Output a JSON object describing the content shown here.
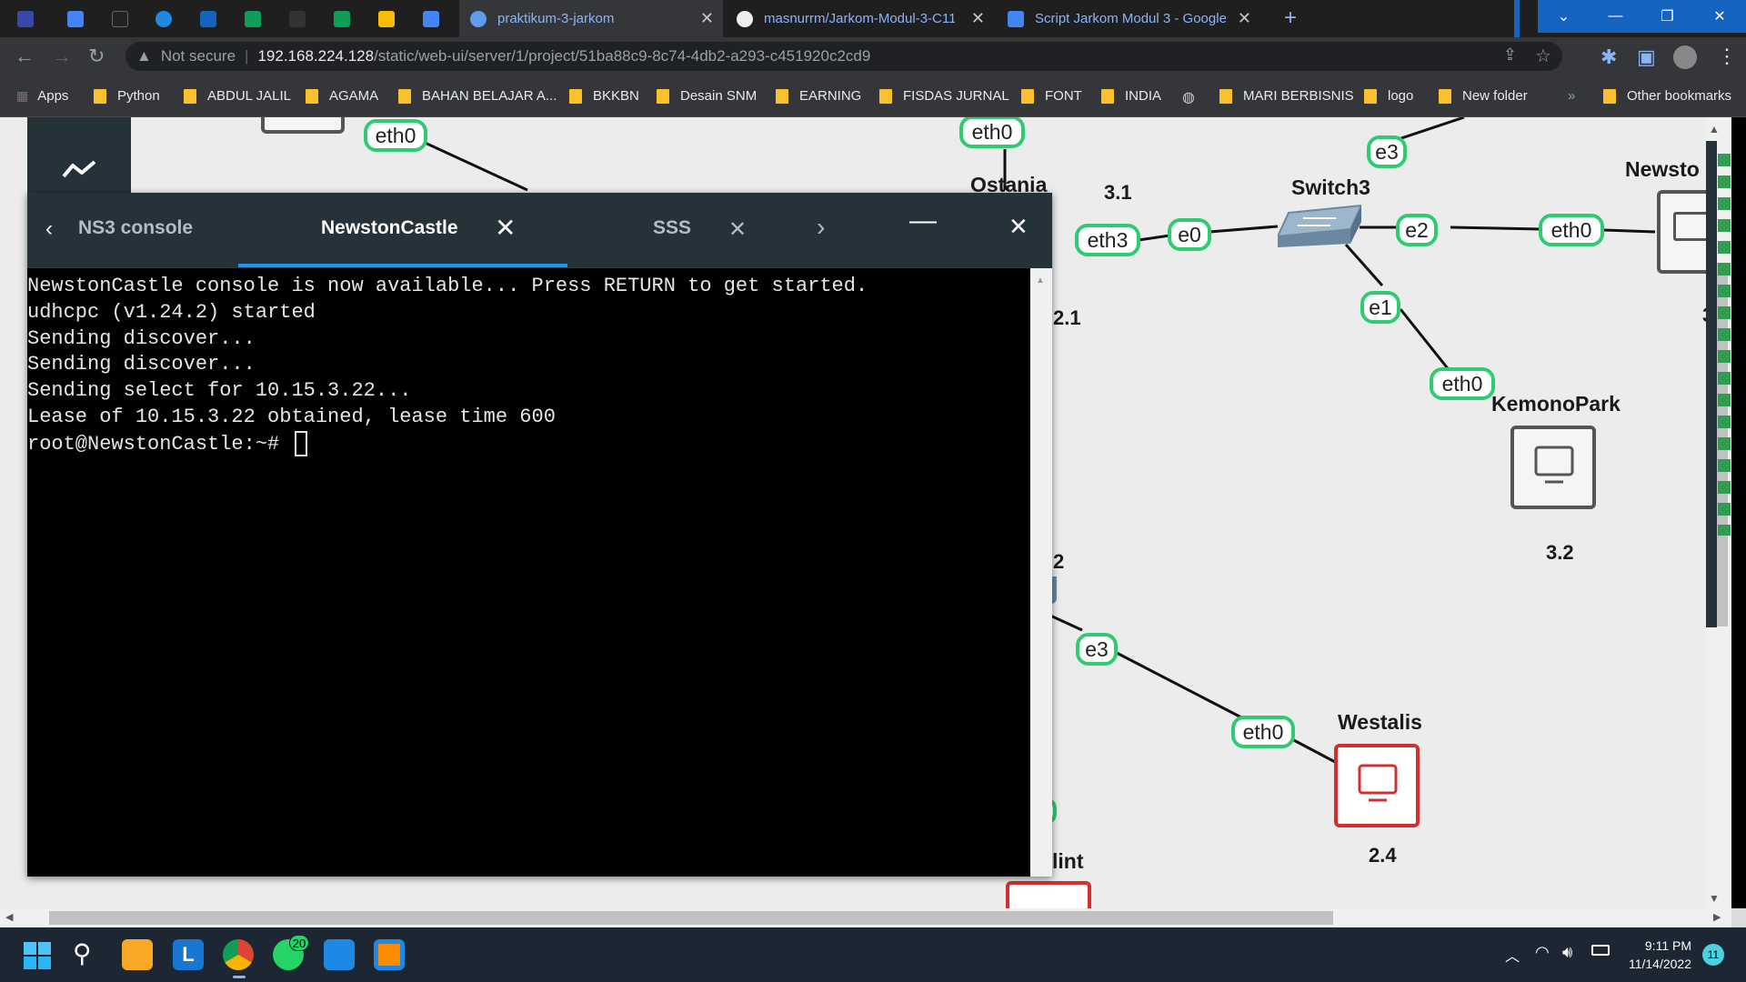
{
  "browser": {
    "tabs": [
      {
        "label": "praktikum-3-jarkom",
        "active": true
      },
      {
        "label": "masnurrm/Jarkom-Modul-3-C11",
        "active": false
      },
      {
        "label": "Script Jarkom Modul 3 - Google",
        "active": false
      }
    ],
    "new_tab": "+",
    "security": "Not secure",
    "url_host": "192.168.224.128",
    "url_path": "/static/web-ui/server/1/project/51ba88c9-8c74-4db2-a293-c451920c2cd9",
    "bookmarks": [
      "Apps",
      "Python",
      "ABDUL JALIL",
      "AGAMA",
      "BAHAN BELAJAR A...",
      "BKKBN",
      "Desain SNM",
      "EARNING",
      "FISDAS JURNAL",
      "FONT",
      "INDIA",
      "MARI BERBISNIS",
      "logo",
      "New folder"
    ],
    "bookmarks_more": "»",
    "other_bookmarks": "Other bookmarks"
  },
  "topology": {
    "nodes": {
      "ostania": "Ostania",
      "switch3": "Switch3",
      "newston": "Newsto",
      "kemonopark": "KemonoPark",
      "westalis": "Westalis",
      "flint": "lint"
    },
    "ip_labels": {
      "ostania_net": "3.1",
      "left_mid": "2.1",
      "kemono_ip": "3.2",
      "westalis_ip": "2.4",
      "lower_left": "2",
      "newston_partial": "3"
    },
    "interfaces": {
      "top_left_eth0": "eth0",
      "ostania_eth0": "eth0",
      "switch_e3": "e3",
      "ostania_eth3": "eth3",
      "switch_e0": "e0",
      "switch_e2": "e2",
      "newston_eth0": "eth0",
      "switch_e1": "e1",
      "kemono_eth0": "eth0",
      "lower_e3": "e3",
      "westalis_eth0": "eth0"
    }
  },
  "console": {
    "tabs": [
      "NS3 console",
      "NewstonCastle",
      "SSS"
    ],
    "lines": [
      "NewstonCastle console is now available... Press RETURN to get started.",
      "udhcpc (v1.24.2) started",
      "Sending discover...",
      "Sending discover...",
      "Sending select for 10.15.3.22...",
      "Lease of 10.15.3.22 obtained, lease time 600",
      "root@NewstonCastle:~# "
    ]
  },
  "taskbar": {
    "whatsapp_badge": "20",
    "time": "9:11 PM",
    "date": "11/14/2022",
    "notifications": "11"
  },
  "colors": {
    "iface_border": "#2ecc71",
    "stopped_node": "#d32f2f",
    "console_header": "#26323a",
    "windows_accent": "#1565c0"
  }
}
